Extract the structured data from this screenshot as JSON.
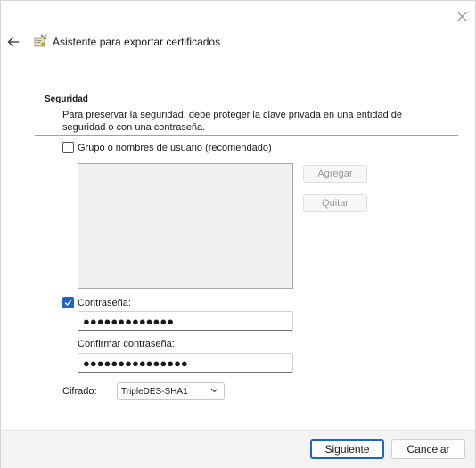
{
  "window": {
    "title": "Asistente para exportar certificados"
  },
  "icons": {
    "close": "close-icon",
    "back": "back-arrow-icon",
    "wizard": "certificate-wizard-icon",
    "checkmark": "checkmark-icon",
    "dropdown": "chevron-down-icon"
  },
  "security": {
    "heading": "Seguridad",
    "description": "Para preservar la seguridad, debe proteger la clave privada en una entidad de seguridad o con una contraseña."
  },
  "group_option": {
    "label": "Grupo o nombres de usuario (recomendado)",
    "checked": false,
    "add_label": "Agregar",
    "remove_label": "Quitar"
  },
  "password_option": {
    "label": "Contraseña:",
    "checked": true,
    "value": "●●●●●●●●●●●●●",
    "confirm_label": "Confirmar contraseña:",
    "confirm_value": "●●●●●●●●●●●●●●●"
  },
  "encryption": {
    "label": "Cifrado:",
    "selected": "TripleDES-SHA1"
  },
  "footer": {
    "next_label": "Siguiente",
    "cancel_label": "Cancelar"
  },
  "colors": {
    "accent": "#1a66c0"
  }
}
